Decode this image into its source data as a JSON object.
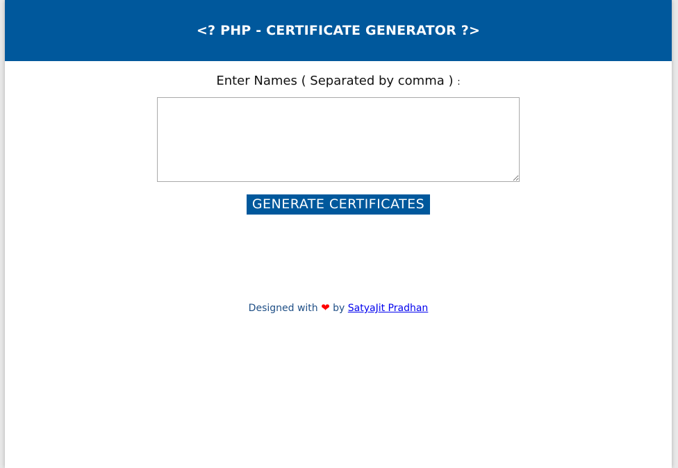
{
  "header": {
    "title": "<? PHP - CERTIFICATE GENERATOR ?>"
  },
  "form": {
    "label": "Enter Names ( Separated by comma )",
    "label_colon": ":",
    "textarea_value": "",
    "button_label": "GENERATE CERTIFICATES"
  },
  "footer": {
    "prefix": "Designed with",
    "heart_icon": "heart-icon",
    "by": "by",
    "author": "SatyaJit Pradhan"
  },
  "colors": {
    "brand": "#00589c",
    "heart": "#ff0000",
    "link": "#0000ee"
  }
}
